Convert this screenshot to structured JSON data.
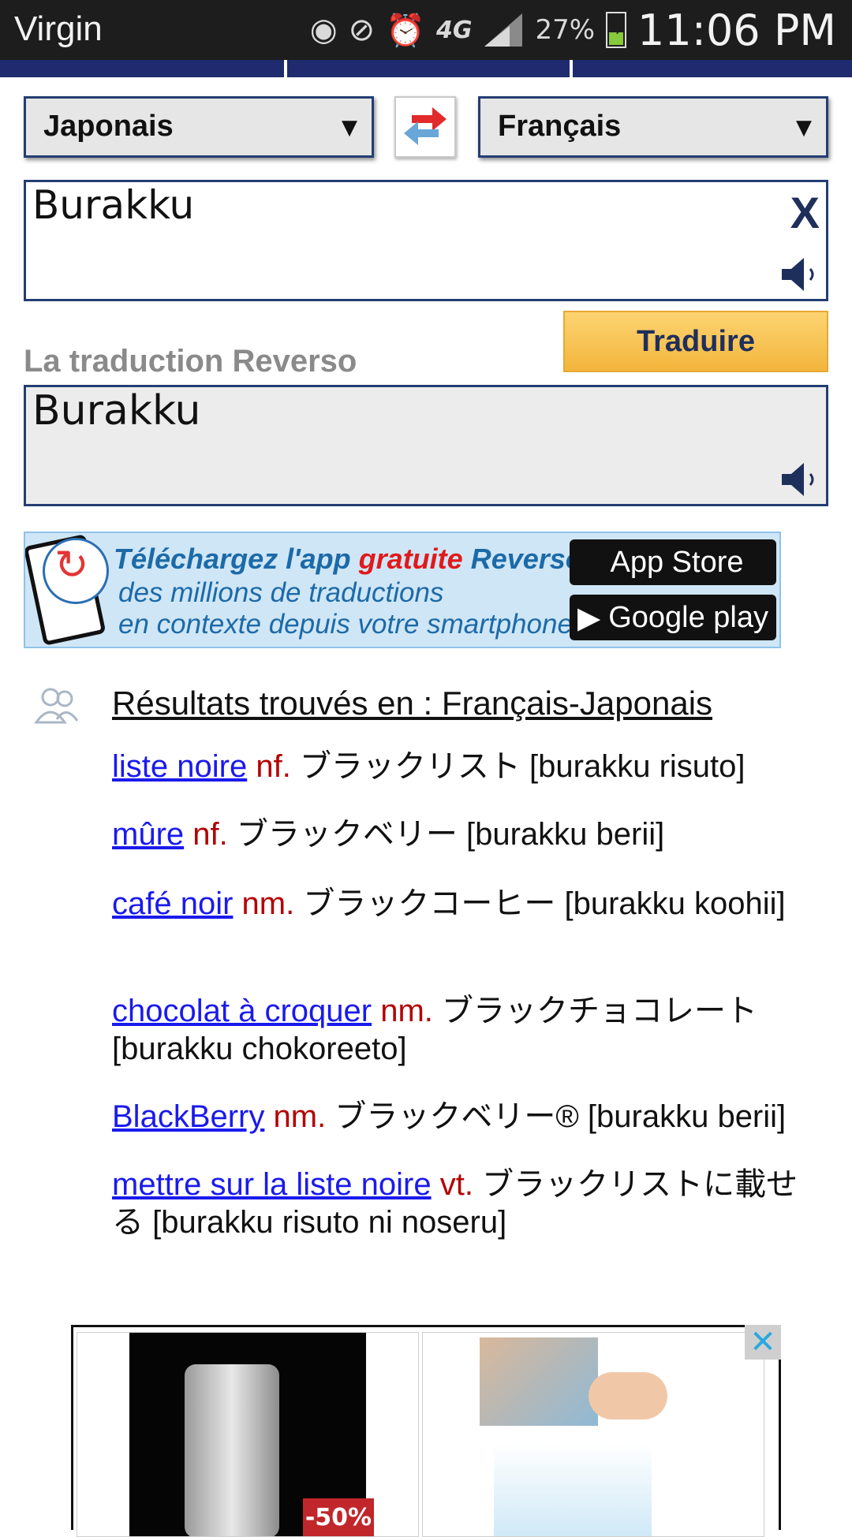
{
  "status_bar": {
    "carrier": "Virgin",
    "network": "4G",
    "battery": "27%",
    "time": "11:06 PM",
    "icons": [
      "eye-icon",
      "no-vibrate-icon",
      "alarm-icon",
      "signal-icon",
      "battery-icon"
    ]
  },
  "translator": {
    "source_language": "Japonais",
    "target_language": "Français",
    "input_text": "Burakku",
    "translate_button": "Traduire",
    "result_label": "La traduction Reverso",
    "output_text": "Burakku"
  },
  "banner": {
    "line1_prefix": "Téléchargez l'app ",
    "line1_highlight": "gratuite",
    "line1_suffix": " Reverso",
    "line2": "des millions de traductions",
    "line3": "en contexte depuis votre smartphone",
    "app_store": "App Store",
    "google_play": "Google play"
  },
  "results": {
    "heading": "Résultats trouvés en : Français-Japonais",
    "entries": [
      {
        "term": "liste noire",
        "pos": "nf.",
        "translation": "ブラックリスト [burakku risuto]"
      },
      {
        "term": "mûre",
        "pos": "nf.",
        "translation": "ブラックベリー [burakku berii]"
      },
      {
        "term": "café noir",
        "pos": "nm.",
        "translation": "ブラックコーヒー [burakku koohii]"
      },
      {
        "term": "chocolat à croquer",
        "pos": "nm.",
        "translation": "ブラックチョコレート [burakku chokoreeto]"
      },
      {
        "term": "BlackBerry",
        "pos": "nm.",
        "translation": "ブラックベリー® [burakku berii]"
      },
      {
        "term": "mettre sur la liste noire",
        "pos": "vt.",
        "translation": "ブラックリストに載せる [burakku risuto ni noseru]"
      }
    ]
  },
  "ad": {
    "discount": "-50%",
    "close": "✕"
  },
  "colors": {
    "nav": "#1f2b6e",
    "link": "#1a1aee",
    "pos": "#b30000",
    "button": "#f3b53c"
  }
}
